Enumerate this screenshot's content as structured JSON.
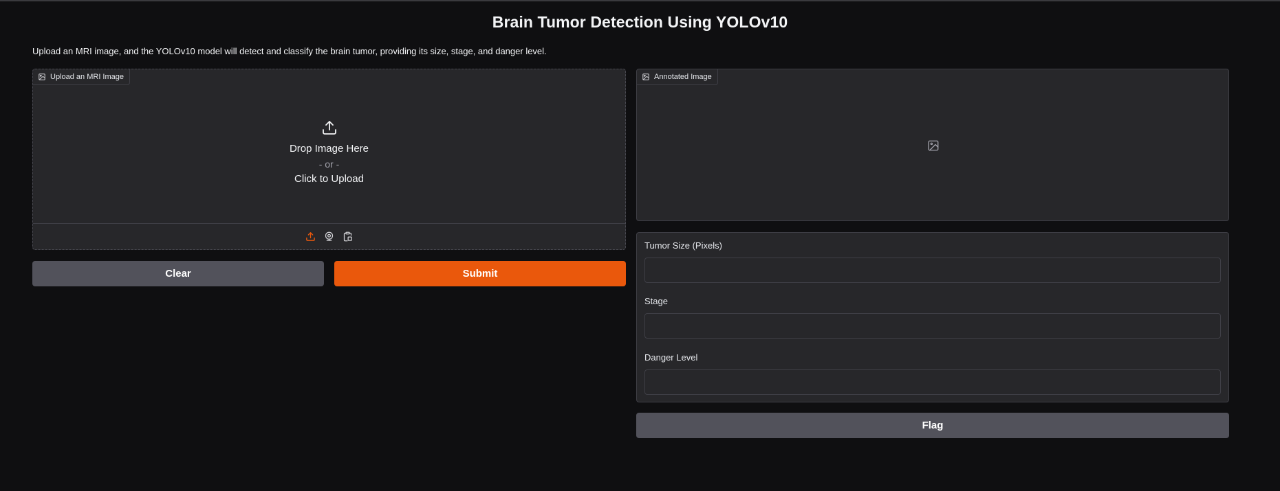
{
  "page": {
    "title": "Brain Tumor Detection Using YOLOv10",
    "description": "Upload an MRI image, and the YOLOv10 model will detect and classify the brain tumor, providing its size, stage, and danger level."
  },
  "input_image": {
    "label": "Upload an MRI Image",
    "drop_text": "Drop Image Here",
    "or_text": "- or -",
    "click_text": "Click to Upload",
    "sources": [
      "upload-icon",
      "webcam-icon",
      "clipboard-icon"
    ]
  },
  "buttons": {
    "clear_label": "Clear",
    "submit_label": "Submit",
    "flag_label": "Flag"
  },
  "output_image": {
    "label": "Annotated Image"
  },
  "outputs": {
    "size_label": "Tumor Size (Pixels)",
    "size_value": "",
    "stage_label": "Stage",
    "stage_value": "",
    "danger_label": "Danger Level",
    "danger_value": ""
  },
  "colors": {
    "background": "#0f0f11",
    "panel": "#27272a",
    "primary": "#ea580c",
    "secondary": "#52525b"
  }
}
